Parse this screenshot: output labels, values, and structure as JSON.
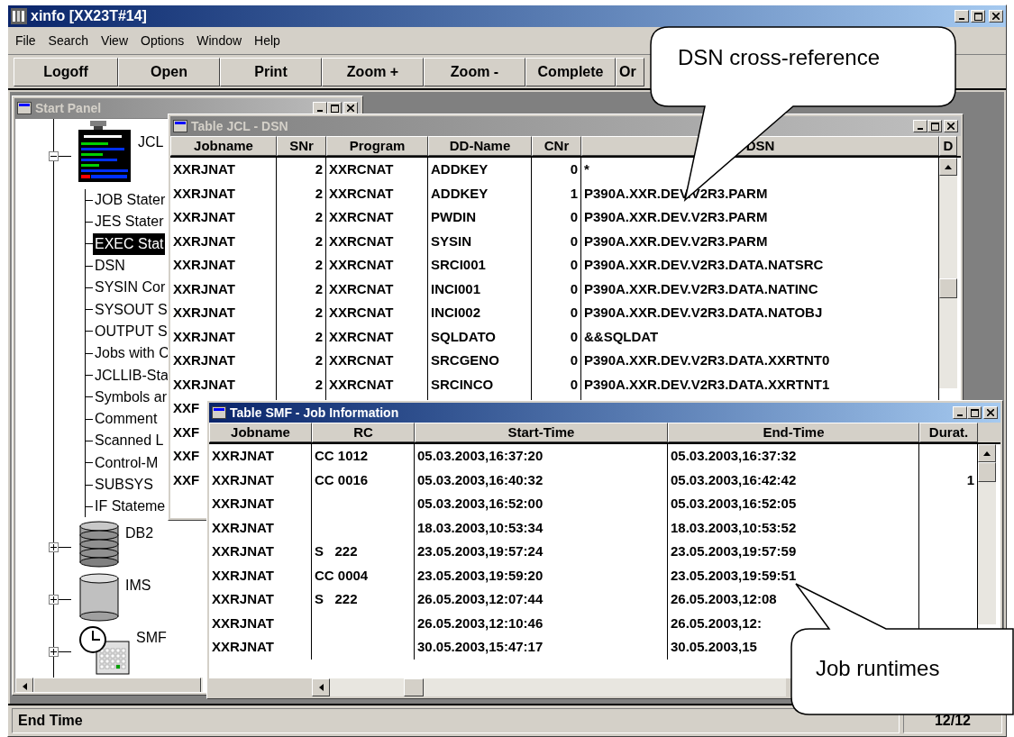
{
  "app": {
    "title": "xinfo [XX23T#14]"
  },
  "menu": [
    "File",
    "Search",
    "View",
    "Options",
    "Window",
    "Help"
  ],
  "toolbar": [
    "Logoff",
    "Open",
    "Print",
    "Zoom +",
    "Zoom -",
    "Complete",
    "Or"
  ],
  "start_panel": {
    "title": "Start Panel",
    "active": false,
    "tree": [
      {
        "label": "JCL",
        "kind": "jcl",
        "expanded": true,
        "children": [
          {
            "label": "JOB Stater",
            "selected": false
          },
          {
            "label": "JES Stater",
            "selected": false
          },
          {
            "label": "EXEC Stat",
            "selected": true
          },
          {
            "label": "DSN",
            "selected": false
          },
          {
            "label": "SYSIN Cor",
            "selected": false
          },
          {
            "label": "SYSOUT S",
            "selected": false
          },
          {
            "label": "OUTPUT S",
            "selected": false
          },
          {
            "label": "Jobs with C",
            "selected": false
          },
          {
            "label": "JCLLIB-Sta",
            "selected": false
          },
          {
            "label": "Symbols ar",
            "selected": false
          },
          {
            "label": "Comment",
            "selected": false
          },
          {
            "label": "Scanned L",
            "selected": false
          },
          {
            "label": "Control-M",
            "selected": false
          },
          {
            "label": "SUBSYS",
            "selected": false
          },
          {
            "label": "IF Stateme",
            "selected": false
          }
        ]
      },
      {
        "label": "DB2",
        "kind": "db2",
        "expanded": false
      },
      {
        "label": "IMS",
        "kind": "ims",
        "expanded": false
      },
      {
        "label": "SMF",
        "kind": "smf",
        "expanded": false
      }
    ]
  },
  "jcl_table": {
    "title": "Table JCL - DSN",
    "active": false,
    "columns": [
      "Jobname",
      "SNr",
      "Program",
      "DD-Name",
      "CNr",
      "DSN",
      "D"
    ],
    "rows": [
      {
        "jobname": "XXRJNAT",
        "snr": "2",
        "program": "XXRCNAT",
        "dd_name": "ADDKEY",
        "cnr": "0",
        "dsn": "*"
      },
      {
        "jobname": "XXRJNAT",
        "snr": "2",
        "program": "XXRCNAT",
        "dd_name": "ADDKEY",
        "cnr": "1",
        "dsn": "P390A.XXR.DEV.V2R3.PARM"
      },
      {
        "jobname": "XXRJNAT",
        "snr": "2",
        "program": "XXRCNAT",
        "dd_name": "PWDIN",
        "cnr": "0",
        "dsn": "P390A.XXR.DEV.V2R3.PARM"
      },
      {
        "jobname": "XXRJNAT",
        "snr": "2",
        "program": "XXRCNAT",
        "dd_name": "SYSIN",
        "cnr": "0",
        "dsn": "P390A.XXR.DEV.V2R3.PARM"
      },
      {
        "jobname": "XXRJNAT",
        "snr": "2",
        "program": "XXRCNAT",
        "dd_name": "SRCI001",
        "cnr": "0",
        "dsn": "P390A.XXR.DEV.V2R3.DATA.NATSRC"
      },
      {
        "jobname": "XXRJNAT",
        "snr": "2",
        "program": "XXRCNAT",
        "dd_name": "INCI001",
        "cnr": "0",
        "dsn": "P390A.XXR.DEV.V2R3.DATA.NATINC"
      },
      {
        "jobname": "XXRJNAT",
        "snr": "2",
        "program": "XXRCNAT",
        "dd_name": "INCI002",
        "cnr": "0",
        "dsn": "P390A.XXR.DEV.V2R3.DATA.NATOBJ"
      },
      {
        "jobname": "XXRJNAT",
        "snr": "2",
        "program": "XXRCNAT",
        "dd_name": "SQLDATO",
        "cnr": "0",
        "dsn": "&&SQLDAT"
      },
      {
        "jobname": "XXRJNAT",
        "snr": "2",
        "program": "XXRCNAT",
        "dd_name": "SRCGENO",
        "cnr": "0",
        "dsn": "P390A.XXR.DEV.V2R3.DATA.XXRTNT0"
      },
      {
        "jobname": "XXRJNAT",
        "snr": "2",
        "program": "XXRCNAT",
        "dd_name": "SRCINCO",
        "cnr": "0",
        "dsn": "P390A.XXR.DEV.V2R3.DATA.XXRTNT1"
      },
      {
        "jobname": "XXF"
      },
      {
        "jobname": "XXF"
      },
      {
        "jobname": "XXF"
      },
      {
        "jobname": "XXF"
      }
    ]
  },
  "smf_table": {
    "title": "Table SMF - Job Information",
    "active": true,
    "columns": [
      "Jobname",
      "RC",
      "Start-Time",
      "End-Time",
      "Durat."
    ],
    "rows": [
      {
        "jobname": "XXRJNAT",
        "rc": "CC 1012",
        "start_time": "05.03.2003,16:37:20",
        "end_time": "05.03.2003,16:37:32"
      },
      {
        "jobname": "XXRJNAT",
        "rc": "CC 0016",
        "start_time": "05.03.2003,16:40:32",
        "end_time": "05.03.2003,16:42:42",
        "duration": "1"
      },
      {
        "jobname": "XXRJNAT",
        "start_time": "05.03.2003,16:52:00",
        "end_time": "05.03.2003,16:52:05"
      },
      {
        "jobname": "XXRJNAT",
        "start_time": "18.03.2003,10:53:34",
        "end_time": "18.03.2003,10:53:52"
      },
      {
        "jobname": "XXRJNAT",
        "rc": "S   222",
        "start_time": "23.05.2003,19:57:24",
        "end_time": "23.05.2003,19:57:59"
      },
      {
        "jobname": "XXRJNAT",
        "rc": "CC 0004",
        "start_time": "23.05.2003,19:59:20",
        "end_time": "23.05.2003,19:59:51"
      },
      {
        "jobname": "XXRJNAT",
        "rc": "S   222",
        "start_time": "26.05.2003,12:07:44",
        "end_time": "26.05.2003,12:08"
      },
      {
        "jobname": "XXRJNAT",
        "start_time": "26.05.2003,12:10:46",
        "end_time": "26.05.2003,12:"
      },
      {
        "jobname": "XXRJNAT",
        "start_time": "30.05.2003,15:47:17",
        "end_time": "30.05.2003,15"
      }
    ]
  },
  "callouts": [
    {
      "text": "DSN cross-reference"
    },
    {
      "text": "Job runtimes"
    }
  ],
  "status_bar": {
    "text": "End Time",
    "count": "12/12"
  }
}
